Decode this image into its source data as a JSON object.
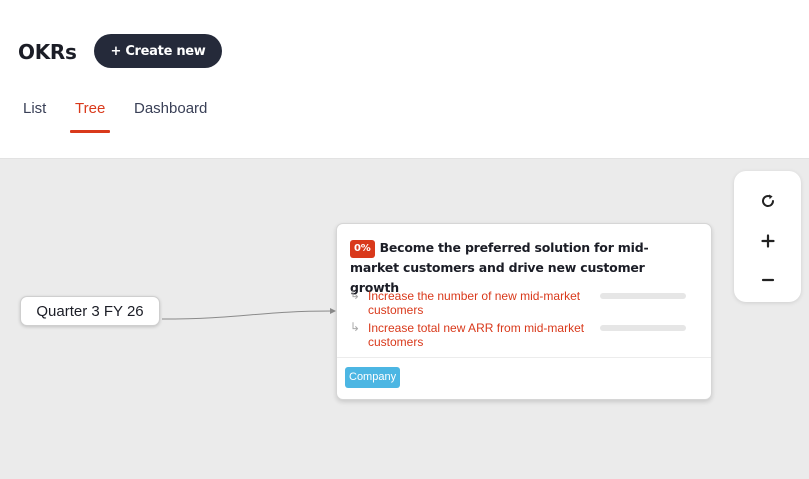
{
  "header": {
    "title": "OKRs",
    "create_label": "+ Create new"
  },
  "tabs": [
    {
      "label": "List",
      "active": false
    },
    {
      "label": "Tree",
      "active": true
    },
    {
      "label": "Dashboard",
      "active": false
    }
  ],
  "tree": {
    "root": {
      "label": "Quarter 3 FY 26"
    },
    "objective": {
      "progress_label": "0%",
      "title": "Become the preferred solution for mid-market customers and drive new customer growth",
      "key_results": [
        {
          "text": "Increase the number of new mid-market customers",
          "progress": 0
        },
        {
          "text": "Increase total new ARR from mid-market customers",
          "progress": 0
        }
      ],
      "tag": "Company"
    }
  },
  "zoom_controls": {
    "reset_icon": "refresh-icon",
    "zoom_in_icon": "plus-icon",
    "zoom_out_icon": "minus-icon"
  },
  "colors": {
    "accent": "#d9391b",
    "dark_button": "#252a3a",
    "tag": "#4cb6e3",
    "canvas": "#ebebeb"
  }
}
